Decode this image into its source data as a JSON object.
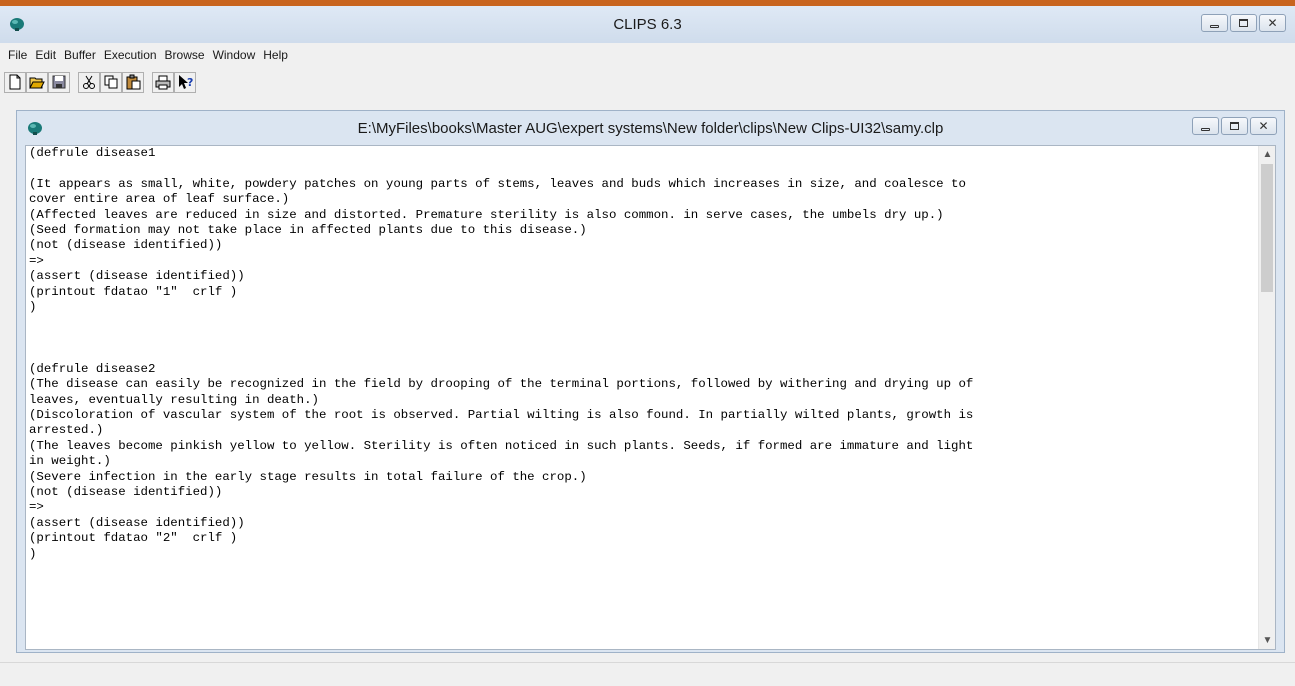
{
  "app": {
    "title": "CLIPS 6.3",
    "icon": "clips-icon",
    "controls": {
      "minimize": "minimize-icon",
      "maximize": "maximize-icon",
      "close": "✕"
    }
  },
  "menu": [
    "File",
    "Edit",
    "Buffer",
    "Execution",
    "Browse",
    "Window",
    "Help"
  ],
  "toolbar": [
    {
      "name": "new-button",
      "icon": "new-file-icon"
    },
    {
      "name": "open-button",
      "icon": "open-folder-icon"
    },
    {
      "name": "save-button",
      "icon": "save-icon"
    },
    {
      "name": "cut-button",
      "icon": "scissors-icon"
    },
    {
      "name": "copy-button",
      "icon": "copy-icon"
    },
    {
      "name": "paste-button",
      "icon": "paste-icon"
    },
    {
      "name": "print-button",
      "icon": "printer-icon"
    },
    {
      "name": "help-button",
      "icon": "context-help-icon"
    }
  ],
  "document": {
    "title": "E:\\MyFiles\\books\\Master AUG\\expert systems\\New folder\\clips\\New Clips-UI32\\samy.clp",
    "lines": [
      "(defrule disease1",
      "",
      "(It appears as small, white, powdery patches on young parts of stems, leaves and buds which increases in size, and coalesce to",
      "cover entire area of leaf surface.)",
      "(Affected leaves are reduced in size and distorted. Premature sterility is also common. in serve cases, the umbels dry up.)",
      "(Seed formation may not take place in affected plants due to this disease.)",
      "(not (disease identified))",
      "=>",
      "(assert (disease identified))",
      "(printout fdatao \"1\"  crlf )",
      ")",
      "",
      "",
      "",
      "(defrule disease2",
      "(The disease can easily be recognized in the field by drooping of the terminal portions, followed by withering and drying up of",
      "leaves, eventually resulting in death.)",
      "(Discoloration of vascular system of the root is observed. Partial wilting is also found. In partially wilted plants, growth is",
      "arrested.)",
      "(The leaves become pinkish yellow to yellow. Sterility is often noticed in such plants. Seeds, if formed are immature and light",
      "in weight.)",
      "(Severe infection in the early stage results in total failure of the crop.)",
      "(not (disease identified))",
      "=>",
      "(assert (disease identified))",
      "(printout fdatao \"2\"  crlf )",
      ")"
    ]
  },
  "scrollbar": {
    "up": "▲",
    "down": "▼"
  }
}
